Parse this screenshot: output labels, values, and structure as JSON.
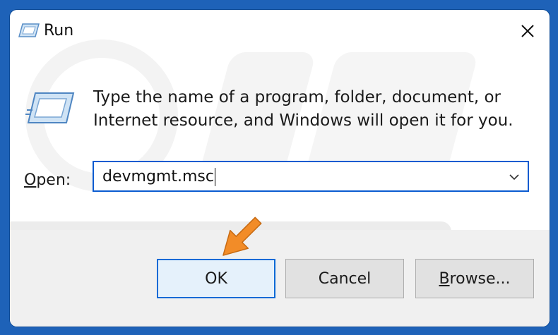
{
  "window": {
    "title": "Run",
    "close_glyph": "✕"
  },
  "content": {
    "description_line1": "Type the name of a program, folder, document, or",
    "description_line2": "Internet resource, and Windows will open it for you.",
    "open_label_underlined": "O",
    "open_label_rest": "pen:",
    "open_value": "devmgmt.msc"
  },
  "buttons": {
    "ok_label": "OK",
    "cancel_label": "Cancel",
    "browse_label_underlined": "B",
    "browse_label_rest": "rowse..."
  },
  "icons": {
    "title": "run-app-icon",
    "content": "run-app-large-icon",
    "close": "close-icon",
    "dropdown": "chevron-down-icon",
    "annotation": "orange-pointer-arrow"
  },
  "colors": {
    "frame_blue": "#1e62b8",
    "focus_blue": "#0a5bd0",
    "annotation_orange": "#f28c28",
    "footer_gray": "#f0f0f0"
  }
}
